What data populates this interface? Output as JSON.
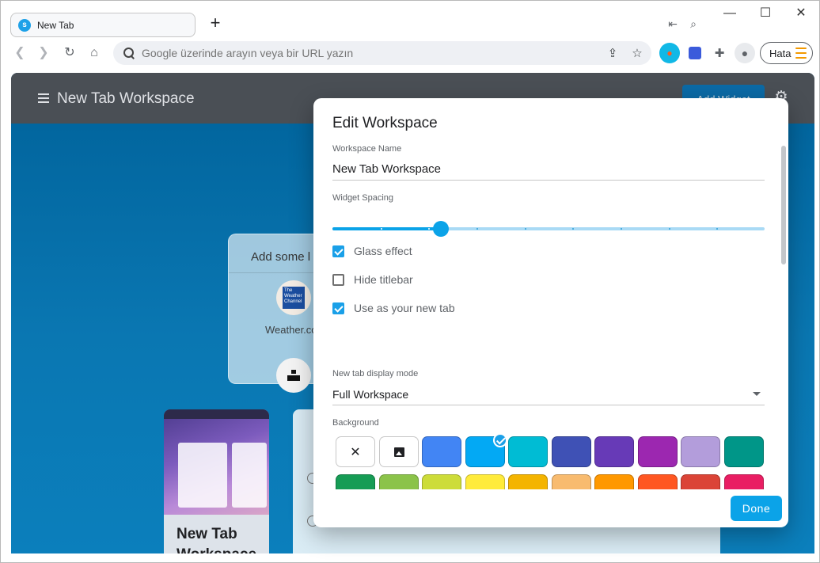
{
  "browser": {
    "tab": {
      "title": "New Tab",
      "favicon": "s"
    },
    "omnibox": {
      "placeholder": "Google üzerinde arayın veya bir URL yazın"
    },
    "profile": {
      "label": "Hata"
    }
  },
  "page": {
    "header": {
      "title": "New Tab Workspace",
      "add_widget": "Add Widget"
    },
    "empty_card": {
      "title": "Add some l",
      "weather_label": "Weather.co",
      "weather_logo_text": "The Weather Channel"
    },
    "thumb_card": {
      "title": "New Tab Workspace"
    }
  },
  "dialog": {
    "title": "Edit Workspace",
    "name_label": "Workspace Name",
    "name_value": "New Tab Workspace",
    "spacing_label": "Widget Spacing",
    "spacing_value": 0.25,
    "spacing_steps": 9,
    "checks": [
      {
        "label": "Glass effect",
        "checked": true
      },
      {
        "label": "Hide titlebar",
        "checked": false
      },
      {
        "label": "Use as your new tab",
        "checked": true
      }
    ],
    "display_mode_label": "New tab display mode",
    "display_mode_value": "Full Workspace",
    "background_label": "Background",
    "swatches": [
      {
        "kind": "none",
        "color": "#ffffff"
      },
      {
        "kind": "image",
        "color": "#ffffff"
      },
      {
        "color": "#4285f4"
      },
      {
        "color": "#03a9f4",
        "selected": true
      },
      {
        "color": "#00bcd4"
      },
      {
        "color": "#3f51b5"
      },
      {
        "color": "#673ab7"
      },
      {
        "color": "#9c27b0"
      },
      {
        "color": "#b39ddb"
      },
      {
        "color": "#009688"
      },
      {
        "color": "#169c55"
      },
      {
        "color": "#8bc34a"
      },
      {
        "color": "#cddc39"
      },
      {
        "color": "#ffeb3b"
      },
      {
        "color": "#f4b400"
      },
      {
        "color": "#f8bb6f"
      },
      {
        "color": "#ff9800"
      },
      {
        "color": "#ff5722"
      },
      {
        "color": "#db4437"
      },
      {
        "color": "#e91e63"
      },
      {
        "color": "#f48fb1"
      },
      {
        "color": "#ffcdd2"
      },
      {
        "color": "#ead7b1"
      },
      {
        "color": "#795548"
      },
      {
        "color": "#9e9e9e"
      },
      {
        "color": "#607d8b"
      },
      {
        "color": "#000000"
      },
      {
        "color": "#ffffff"
      }
    ],
    "done_label": "Done"
  }
}
